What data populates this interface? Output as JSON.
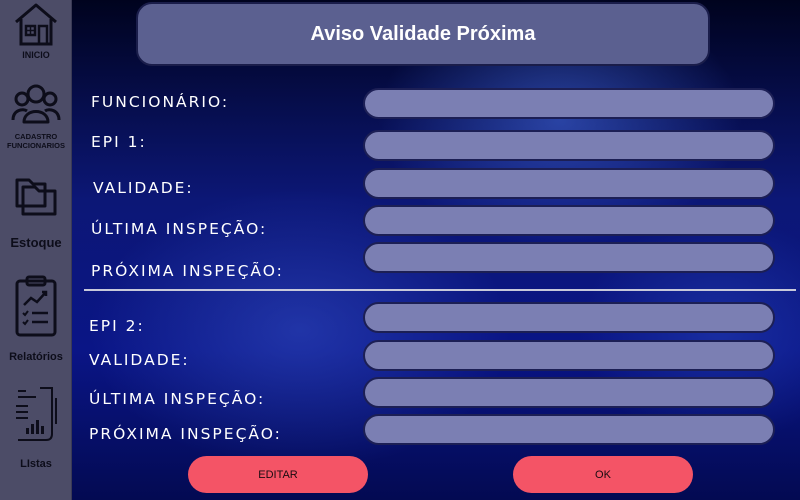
{
  "sidebar": {
    "items": [
      {
        "icon": "home-icon",
        "label": "INICIO"
      },
      {
        "icon": "users-icon",
        "label": "CADASTRO FUNCIONARIOS"
      },
      {
        "icon": "folders-icon",
        "label": "Estoque"
      },
      {
        "icon": "clipboard-chart-icon",
        "label": "Relatórios"
      },
      {
        "icon": "list-report-icon",
        "label": "LIstas"
      }
    ]
  },
  "header": {
    "title": "Aviso Validade Próxima"
  },
  "form": {
    "employee_label": "FUNCIONÁRIO:",
    "employee_value": "",
    "epi1": {
      "label": "EPI 1:",
      "validity_label": "VALIDADE:",
      "last_inspection_label": "ÚLTIMA INSPEÇÃO:",
      "next_inspection_label": "PRÓXIMA INSPEÇÃO:"
    },
    "epi2": {
      "label": "EPI 2:",
      "validity_label": "VALIDADE:",
      "last_inspection_label": "ÚLTIMA INSPEÇÃO:",
      "next_inspection_label": "PRÓXIMA INSPEÇÃO:"
    }
  },
  "actions": {
    "edit_label": "EDITAR",
    "ok_label": "OK"
  },
  "colors": {
    "sidebar_bg": "#4c4c67",
    "title_bg": "#5b6090",
    "input_bg": "#7b7fb3",
    "button_bg": "#f45466",
    "background": "#0a1586"
  }
}
